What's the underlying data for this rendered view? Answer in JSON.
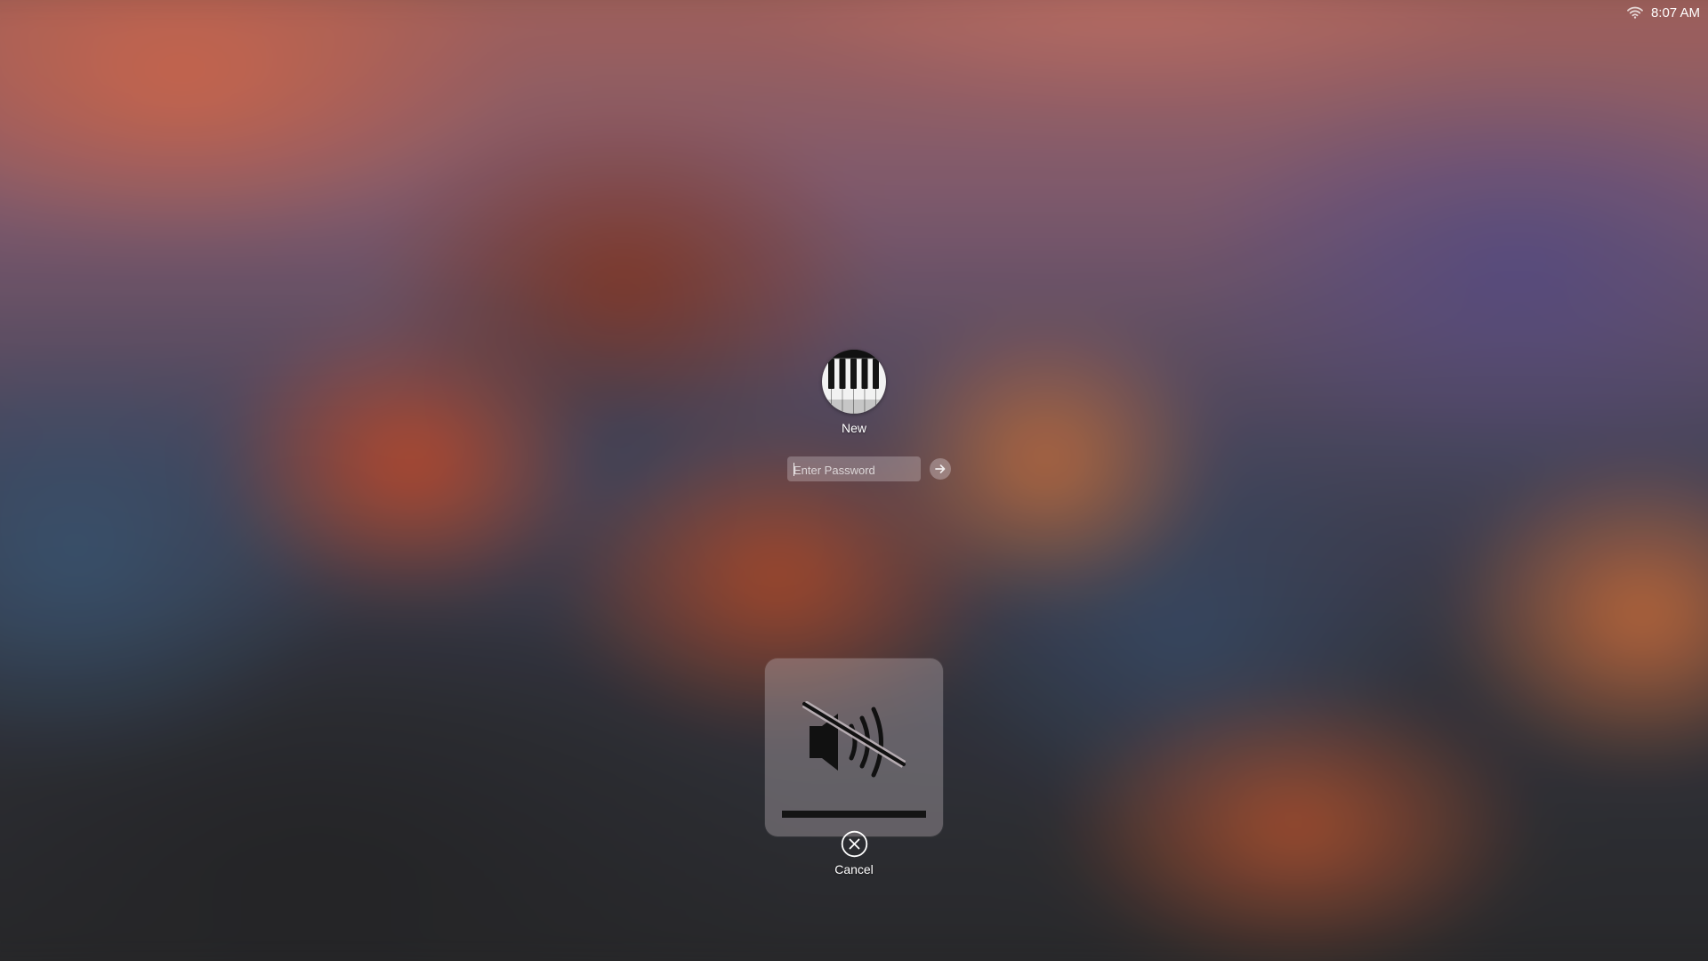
{
  "menubar": {
    "wifi_icon": "wifi-icon",
    "clock": "8:07 AM"
  },
  "login": {
    "avatar_icon": "piano-keys-avatar",
    "username": "New",
    "password": {
      "value": "",
      "placeholder": "Enter Password"
    },
    "submit_icon": "arrow-right-icon"
  },
  "volume_hud": {
    "icon": "speaker-muted-icon",
    "muted": true,
    "level": 0,
    "segments": 16
  },
  "cancel": {
    "icon": "close-circle-icon",
    "label": "Cancel"
  },
  "colors": {
    "hud_background": "#bcb4b9",
    "volume_track": "#141414",
    "text": "#ffffff"
  }
}
